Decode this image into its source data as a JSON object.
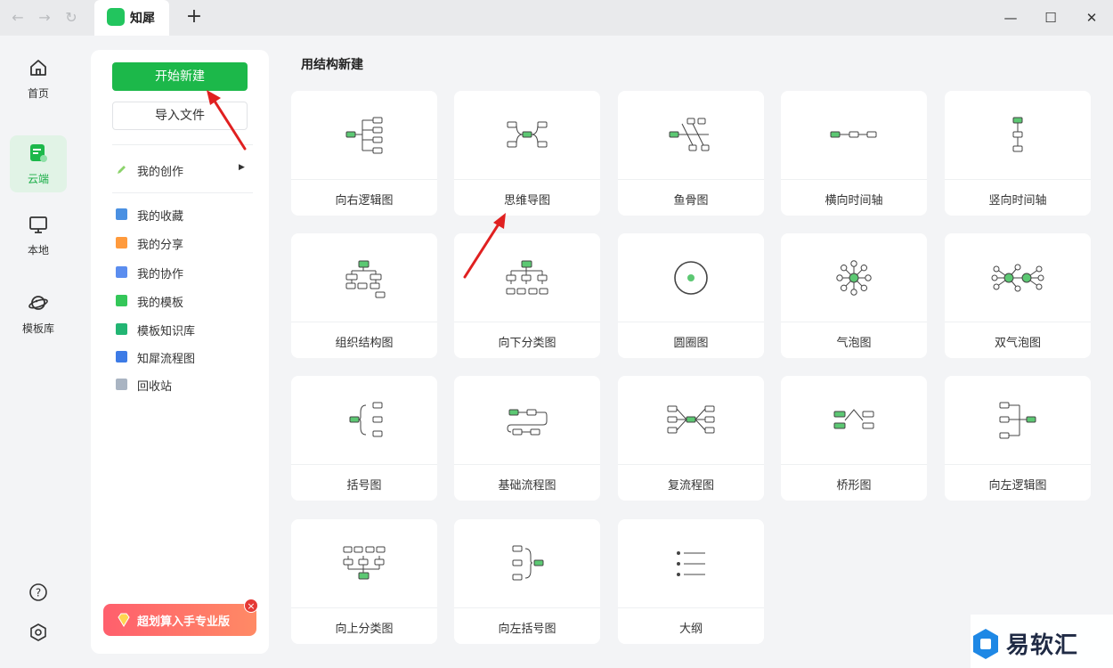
{
  "app": {
    "tab_title": "知犀"
  },
  "window": {
    "minimize_label": "—",
    "maximize_label": "☐",
    "close_label": "✕",
    "new_tab_label": "+"
  },
  "rail": {
    "items": [
      {
        "label": "首页",
        "icon": "home-icon"
      },
      {
        "label": "云端",
        "icon": "cloud-doc-icon",
        "active": true
      },
      {
        "label": "本地",
        "icon": "monitor-icon"
      },
      {
        "label": "模板库",
        "icon": "planet-icon"
      }
    ],
    "bottom": [
      "help-icon",
      "settings-icon"
    ]
  },
  "panel": {
    "new_button": "开始新建",
    "import_button": "导入文件",
    "my_creations": "我的创作",
    "menu": [
      {
        "label": "我的收藏",
        "color": "#4a90e2"
      },
      {
        "label": "我的分享",
        "color": "#ff9a3c"
      },
      {
        "label": "我的协作",
        "color": "#5b8def"
      },
      {
        "label": "我的模板",
        "color": "#34c759"
      },
      {
        "label": "模板知识库",
        "color": "#22b573"
      },
      {
        "label": "知犀流程图",
        "color": "#3d7be6"
      },
      {
        "label": "回收站",
        "color": "#a9b4c2"
      }
    ],
    "promo": "超划算入手专业版",
    "promo_close": "×"
  },
  "main": {
    "section_title": "用结构新建",
    "cards": [
      {
        "label": "向右逻辑图",
        "icon": "logic-right-icon"
      },
      {
        "label": "思维导图",
        "icon": "mindmap-icon"
      },
      {
        "label": "鱼骨图",
        "icon": "fishbone-icon"
      },
      {
        "label": "横向时间轴",
        "icon": "timeline-horizontal-icon"
      },
      {
        "label": "竖向时间轴",
        "icon": "timeline-vertical-icon"
      },
      {
        "label": "组织结构图",
        "icon": "org-chart-icon"
      },
      {
        "label": "向下分类图",
        "icon": "tree-down-icon"
      },
      {
        "label": "圆圈图",
        "icon": "circle-map-icon"
      },
      {
        "label": "气泡图",
        "icon": "bubble-map-icon"
      },
      {
        "label": "双气泡图",
        "icon": "double-bubble-icon"
      },
      {
        "label": "括号图",
        "icon": "brace-map-icon"
      },
      {
        "label": "基础流程图",
        "icon": "basic-flow-icon"
      },
      {
        "label": "复流程图",
        "icon": "multi-flow-icon"
      },
      {
        "label": "桥形图",
        "icon": "bridge-map-icon"
      },
      {
        "label": "向左逻辑图",
        "icon": "logic-left-icon"
      },
      {
        "label": "向上分类图",
        "icon": "tree-up-icon"
      },
      {
        "label": "向左括号图",
        "icon": "brace-left-icon"
      },
      {
        "label": "大纲",
        "icon": "outline-icon"
      }
    ]
  },
  "watermark": {
    "text": "易软汇"
  },
  "colors": {
    "accent": "#1cb84a",
    "node": "#5cc873",
    "annotation": "#e02020"
  }
}
